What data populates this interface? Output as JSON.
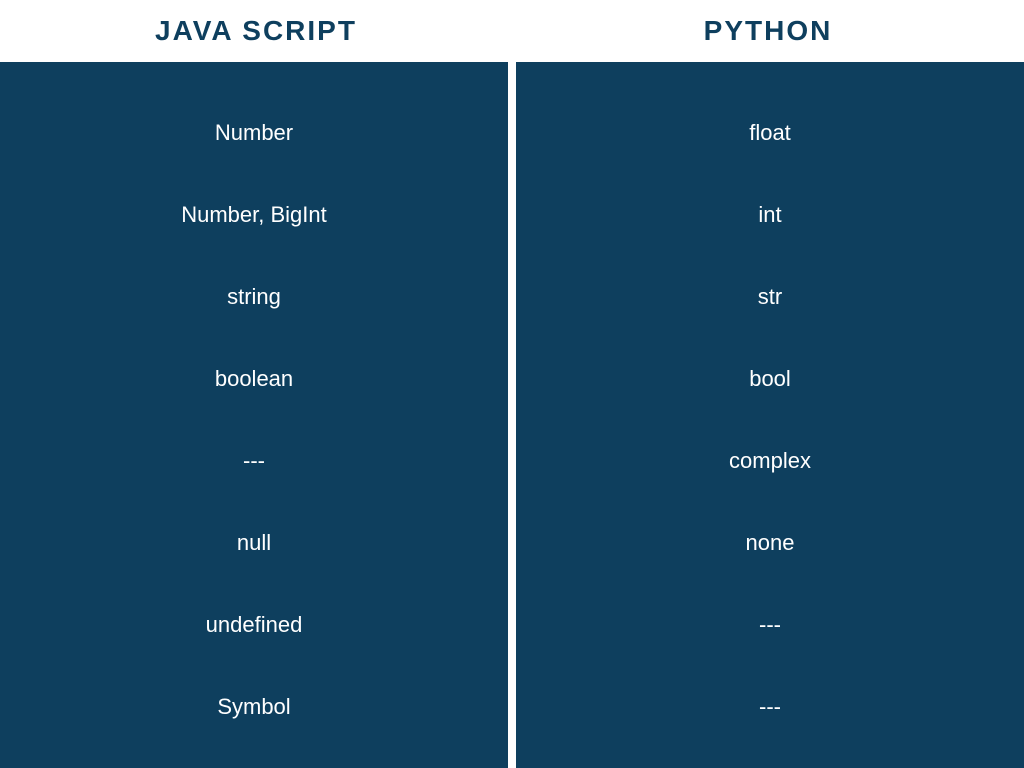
{
  "headers": {
    "left": "JAVA SCRIPT",
    "right": "PYTHON"
  },
  "rows": [
    {
      "js": "Number",
      "py": "float"
    },
    {
      "js": "Number, BigInt",
      "py": "int"
    },
    {
      "js": "string",
      "py": "str"
    },
    {
      "js": "boolean",
      "py": "bool"
    },
    {
      "js": "---",
      "py": "complex"
    },
    {
      "js": "null",
      "py": "none"
    },
    {
      "js": "undefined",
      "py": "---"
    },
    {
      "js": "Symbol",
      "py": "---"
    }
  ],
  "colors": {
    "primary": "#0e3f5e",
    "text_light": "#ffffff"
  },
  "chart_data": {
    "type": "table",
    "title": "",
    "columns": [
      "JAVA SCRIPT",
      "PYTHON"
    ],
    "data": [
      [
        "Number",
        "float"
      ],
      [
        "Number, BigInt",
        "int"
      ],
      [
        "string",
        "str"
      ],
      [
        "boolean",
        "bool"
      ],
      [
        "---",
        "complex"
      ],
      [
        "null",
        "none"
      ],
      [
        "undefined",
        "---"
      ],
      [
        "Symbol",
        "---"
      ]
    ]
  }
}
